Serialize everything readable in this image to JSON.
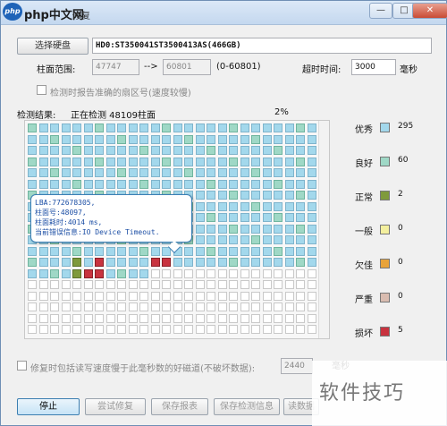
{
  "window": {
    "logo_text": "php中文网",
    "title_suffix": "修复",
    "buttons": {
      "minimize": "—",
      "maximize": "□",
      "close": "✕"
    }
  },
  "top": {
    "select_disk_button": "选择硬盘",
    "disk_name": "HD0:ST350041ST3500413AS(466GB)",
    "cyl_range_label": "柱面范围:",
    "cyl_from": "47747",
    "arrow": "-->",
    "cyl_to": "60801",
    "cyl_range_note": "(0-60801)",
    "timeout_label": "超时时间:",
    "timeout_value": "3000",
    "timeout_unit": "毫秒",
    "report_checkbox_label": "检测时报告准确的扇区号(速度较慢)"
  },
  "status": {
    "result_label": "检测结果:",
    "progress_text": "正在检测 48109柱面",
    "percent": "2%"
  },
  "legend": [
    {
      "label": "优秀",
      "count": "295",
      "color": "#a3d8ec"
    },
    {
      "label": "良好",
      "count": "60",
      "color": "#9fd8c6"
    },
    {
      "label": "正常",
      "count": "2",
      "color": "#7f9a3c"
    },
    {
      "label": "一般",
      "count": "0",
      "color": "#f3ef9e"
    },
    {
      "label": "欠佳",
      "count": "0",
      "color": "#e8a33a"
    },
    {
      "label": "严重",
      "count": "0",
      "color": "#d9bcb0"
    },
    {
      "label": "损坏",
      "count": "5",
      "color": "#c8333f"
    }
  ],
  "tooltip": {
    "lba": "LBA:772678305,",
    "cylinder": "柱面号:48097,",
    "time": "柱面耗时:4014 ms,",
    "error": "当前错误信息:IO Device Timeout."
  },
  "bottom": {
    "slow_checkbox_label": "修复时包括读写速度慢于此毫秒数的好磁道(不破坏数据):",
    "slow_value": "2440",
    "slow_unit": "毫秒",
    "stop_button": "停止",
    "try_repair_button": "尝试修复",
    "save_report_button": "保存报表",
    "save_info_button": "保存检测信息",
    "read_data_button": "读数据"
  },
  "watermark": "软件技巧"
}
